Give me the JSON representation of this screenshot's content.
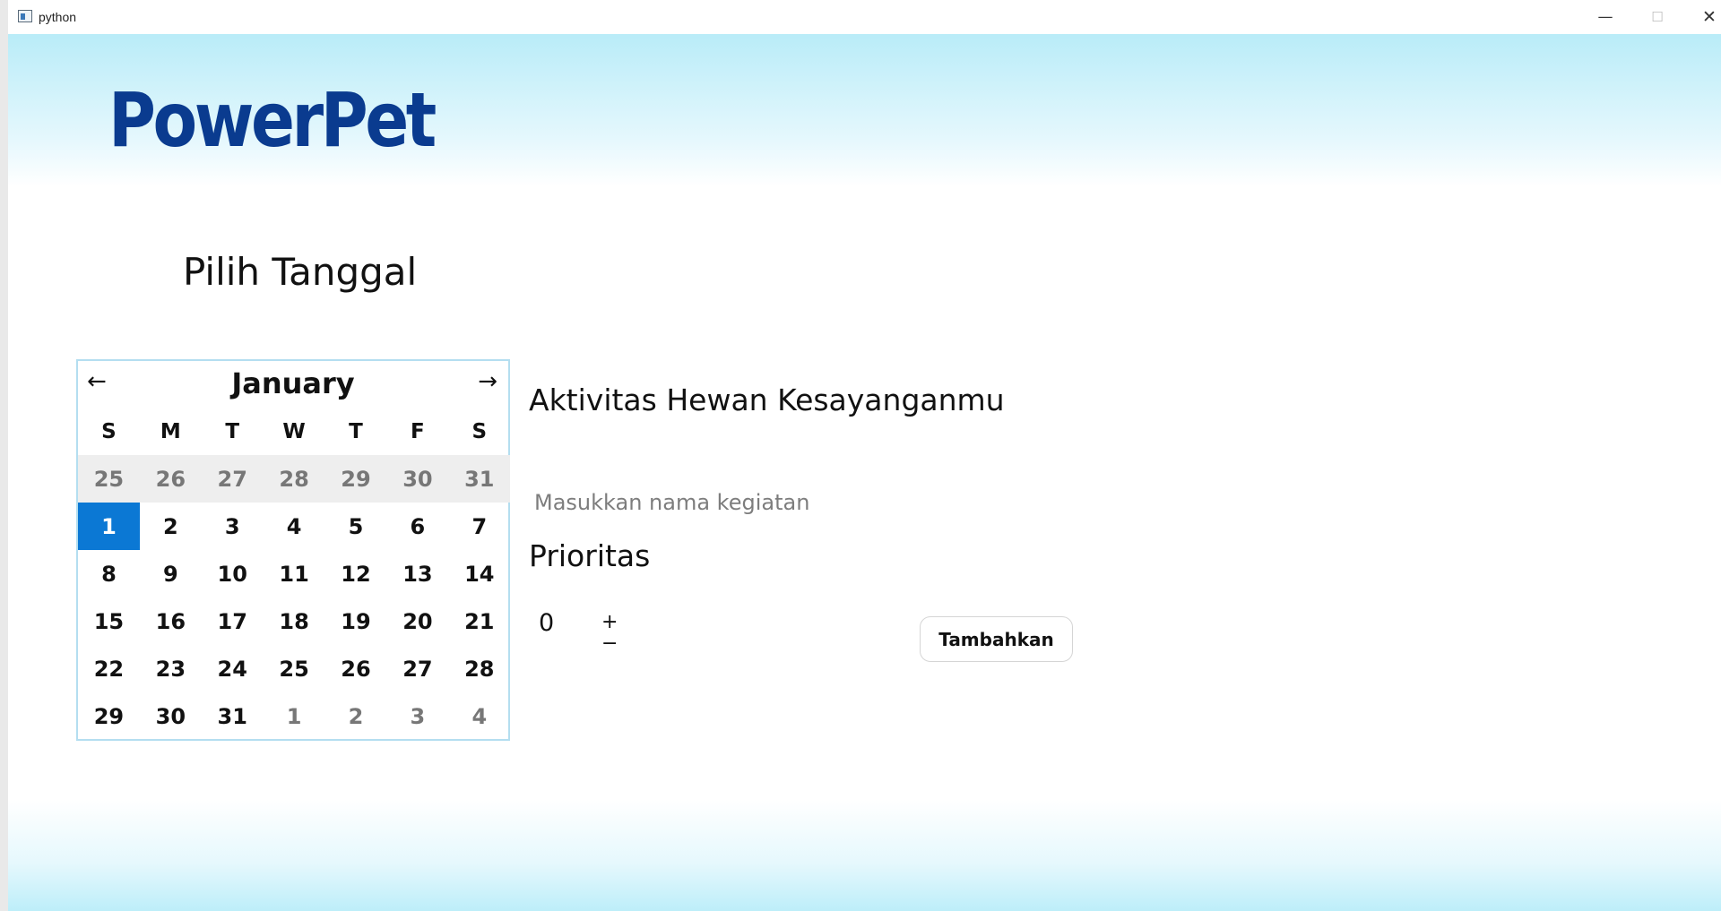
{
  "window": {
    "title": "python",
    "controls": {
      "minimize": "—",
      "maximize": "☐",
      "close": "✕"
    },
    "icon": "window-app-icon"
  },
  "header": {
    "logo_text": "PowerPet",
    "colors": {
      "logo": "#0a3b8f",
      "gradient_top": "#b9ecf8"
    }
  },
  "date_section": {
    "heading": "Pilih Tanggal"
  },
  "calendar": {
    "month": "January",
    "prev_icon": "←",
    "next_icon": "→",
    "weekdays": [
      "S",
      "M",
      "T",
      "W",
      "T",
      "F",
      "S"
    ],
    "weeks": [
      [
        "25",
        "26",
        "27",
        "28",
        "29",
        "30",
        "31"
      ],
      [
        "1",
        "2",
        "3",
        "4",
        "5",
        "6",
        "7"
      ],
      [
        "8",
        "9",
        "10",
        "11",
        "12",
        "13",
        "14"
      ],
      [
        "15",
        "16",
        "17",
        "18",
        "19",
        "20",
        "21"
      ],
      [
        "22",
        "23",
        "24",
        "25",
        "26",
        "27",
        "28"
      ],
      [
        "29",
        "30",
        "31",
        "1",
        "2",
        "3",
        "4"
      ]
    ],
    "selected_day": "1",
    "selected_color": "#0b78d4"
  },
  "activity": {
    "heading": "Aktivitas Hewan Kesayanganmu",
    "input_value": "",
    "input_placeholder": "Masukkan nama kegiatan"
  },
  "priority": {
    "label": "Prioritas",
    "value": "0",
    "increment": "+",
    "decrement": "−"
  },
  "add_button": {
    "label": "Tambahkan"
  }
}
